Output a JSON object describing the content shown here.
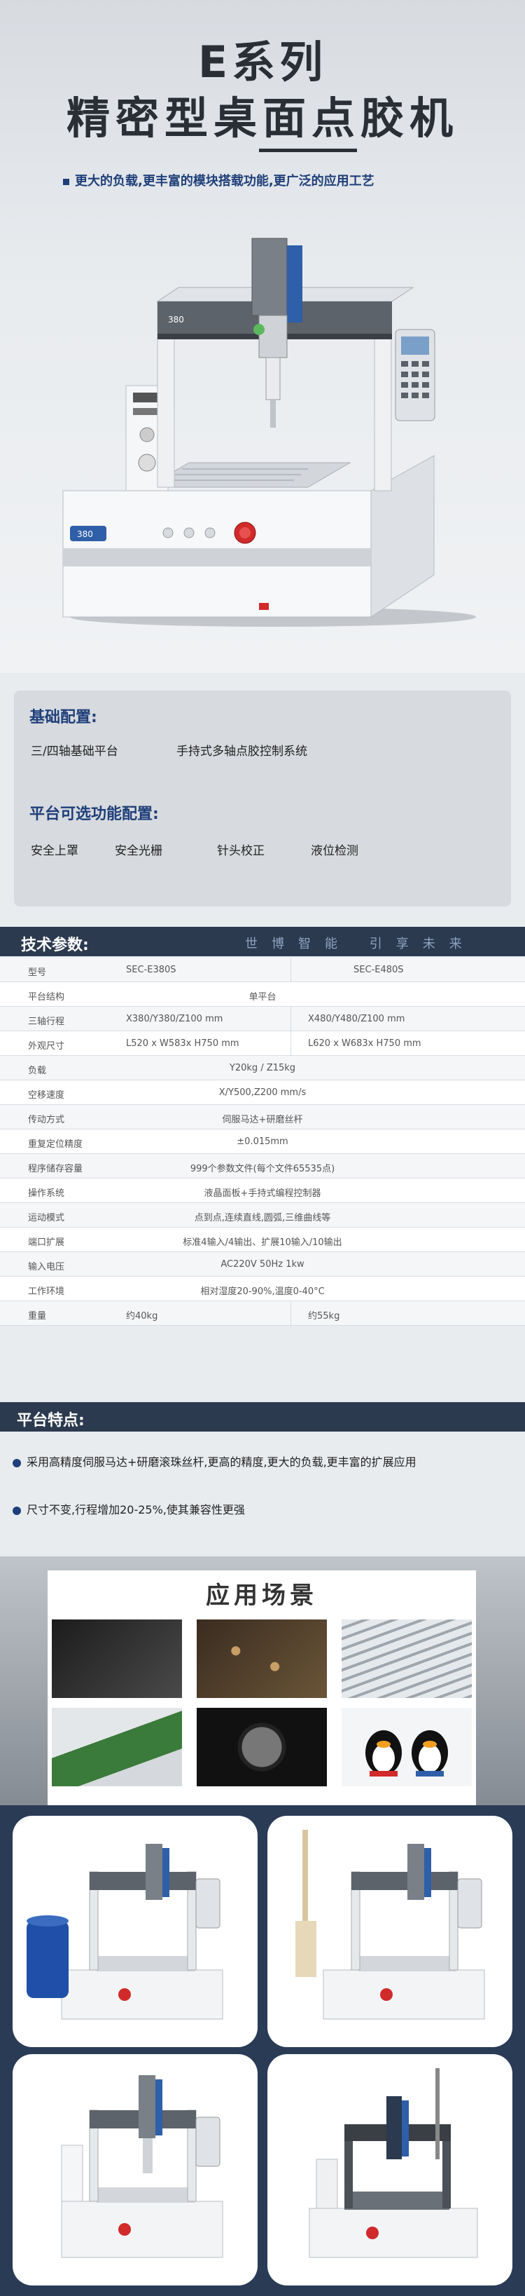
{
  "hero": {
    "title_line1": "E系列",
    "title_line2": "精密型桌面点胶机",
    "tagline": "更大的负载,更丰富的模块搭载功能,更广泛的应用工艺",
    "machine_logo": "380"
  },
  "config": {
    "basic_heading": "基础配置:",
    "basic_items": [
      "三/四轴基础平台",
      "手持式多轴点胶控制系统"
    ],
    "optional_heading": "平台可选功能配置:",
    "optional_items": [
      "安全上罩",
      "安全光栅",
      "针头校正",
      "液位检测"
    ]
  },
  "spec": {
    "heading": "技术参数:",
    "motto": "世博智能 引享未来",
    "rows": [
      {
        "k": "型号",
        "a": "SEC-E380S",
        "b": "SEC-E480S",
        "split": true
      },
      {
        "k": "平台结构",
        "a": "单平台",
        "split": false
      },
      {
        "k": "三轴行程",
        "a": "X380/Y380/Z100 mm",
        "b": "X480/Y480/Z100 mm",
        "split": true
      },
      {
        "k": "外观尺寸",
        "a": "L520 x W583x H750 mm",
        "b": "L620 x W683x H750 mm",
        "split": true
      },
      {
        "k": "负载",
        "a": "Y20kg / Z15kg",
        "split": false
      },
      {
        "k": "空移速度",
        "a": "X/Y500,Z200 mm/s",
        "split": false
      },
      {
        "k": "传动方式",
        "a": "伺服马达+研磨丝杆",
        "split": false
      },
      {
        "k": "重复定位精度",
        "a": "±0.015mm",
        "split": false
      },
      {
        "k": "程序储存容量",
        "a": "999个参数文件(每个文件65535点)",
        "split": false
      },
      {
        "k": "操作系统",
        "a": "液晶面板+手持式编程控制器",
        "split": false
      },
      {
        "k": "运动模式",
        "a": "点到点,连续直线,圆弧,三维曲线等",
        "split": false
      },
      {
        "k": "端口扩展",
        "a": "标准4输入/4输出、扩展10输入/10输出",
        "split": false
      },
      {
        "k": "输入电压",
        "a": "AC220V 50Hz 1kw",
        "split": false
      },
      {
        "k": "工作环境",
        "a": "相对湿度20-90%,温度0-40°C",
        "split": false
      },
      {
        "k": "重量",
        "a": "约40kg",
        "b": "约55kg",
        "split": true
      }
    ]
  },
  "features": {
    "heading": "平台特点:",
    "items": [
      "采用高精度伺服马达+研磨滚珠丝杆,更高的精度,更大的负载,更丰富的扩展应用",
      "尺寸不变,行程增加20-25%,使其兼容性更强"
    ]
  },
  "applications": {
    "title": "应用场景"
  },
  "colors": {
    "brand_navy": "#2b3a4f",
    "brand_blue": "#1f3f7a",
    "accent_red": "#d12a2a"
  }
}
